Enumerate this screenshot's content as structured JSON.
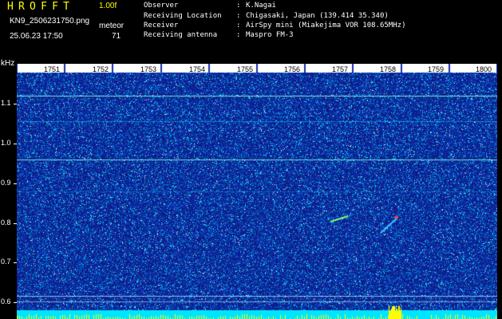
{
  "header": {
    "app_title": "HROFFT",
    "version": "1.00f",
    "filename": "KN9_2506231750.png",
    "datetime": "25.06.23 17:50",
    "meteor_label": "meteor",
    "meteor_count": "71"
  },
  "info": [
    {
      "key": "Observer",
      "sep": ":",
      "value": "K.Nagai"
    },
    {
      "key": "Receiving Location",
      "sep": ":",
      "value": "Chigasaki, Japan (139.414 35.340)"
    },
    {
      "key": "Receiver",
      "sep": ":",
      "value": "AirSpy mini (Miakejima VOR 108.65MHz)"
    },
    {
      "key": "Receiving antenna",
      "sep": ":",
      "value": "Maspro FM-3"
    }
  ],
  "axis": {
    "unit": "kHz",
    "y_ticks": [
      "1.1",
      "1.0",
      "0.9",
      "0.8",
      "0.7",
      "0.6"
    ],
    "x_ticks": [
      "1751",
      "1752",
      "1753",
      "1754",
      "1755",
      "1756",
      "1757",
      "1758",
      "1759",
      "1800"
    ]
  },
  "colors": {
    "background": "#000000",
    "title_yellow": "#ffff00",
    "spectrum_base": "#0c1a8c",
    "noise_cyan": "#00d8ff",
    "bottom_band": "#00e5ff",
    "peak_yellow": "#ffff00"
  }
}
